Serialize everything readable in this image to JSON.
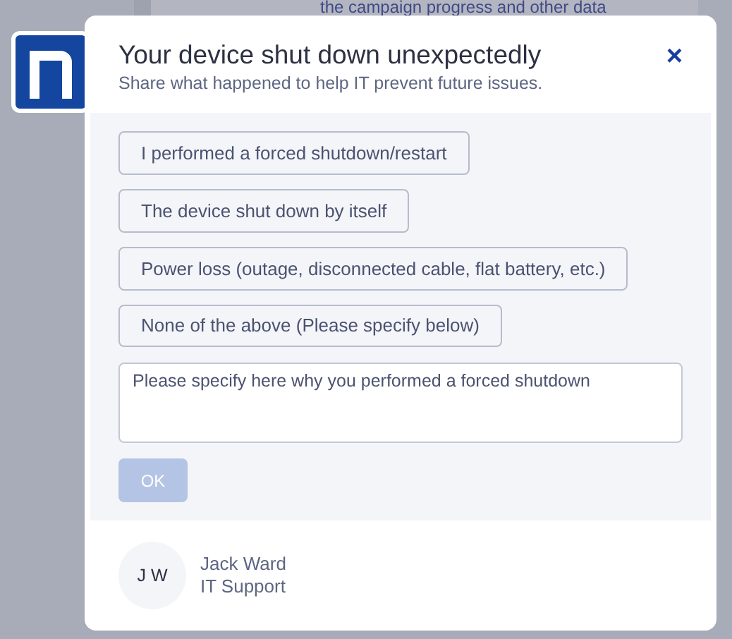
{
  "background": {
    "text": "the campaign progress and other data"
  },
  "dialog": {
    "title": "Your device shut down unexpectedly",
    "subtitle": "Share what happened to help IT prevent future issues.",
    "close": "×",
    "options": [
      {
        "label": "I performed a forced shutdown/restart",
        "selected": false
      },
      {
        "label": "The device shut down by itself",
        "selected": false
      },
      {
        "label": "Power loss (outage, disconnected cable, flat battery, etc.)",
        "selected": false
      },
      {
        "label": "None of the above (Please specify below)",
        "selected": false
      }
    ],
    "comment": {
      "placeholder": "Please specify here why you performed a forced shutdown"
    },
    "ok": {
      "label": "OK",
      "disabled": true
    },
    "sender": {
      "initials": "J W",
      "name": "Jack Ward",
      "role": "IT Support"
    }
  }
}
